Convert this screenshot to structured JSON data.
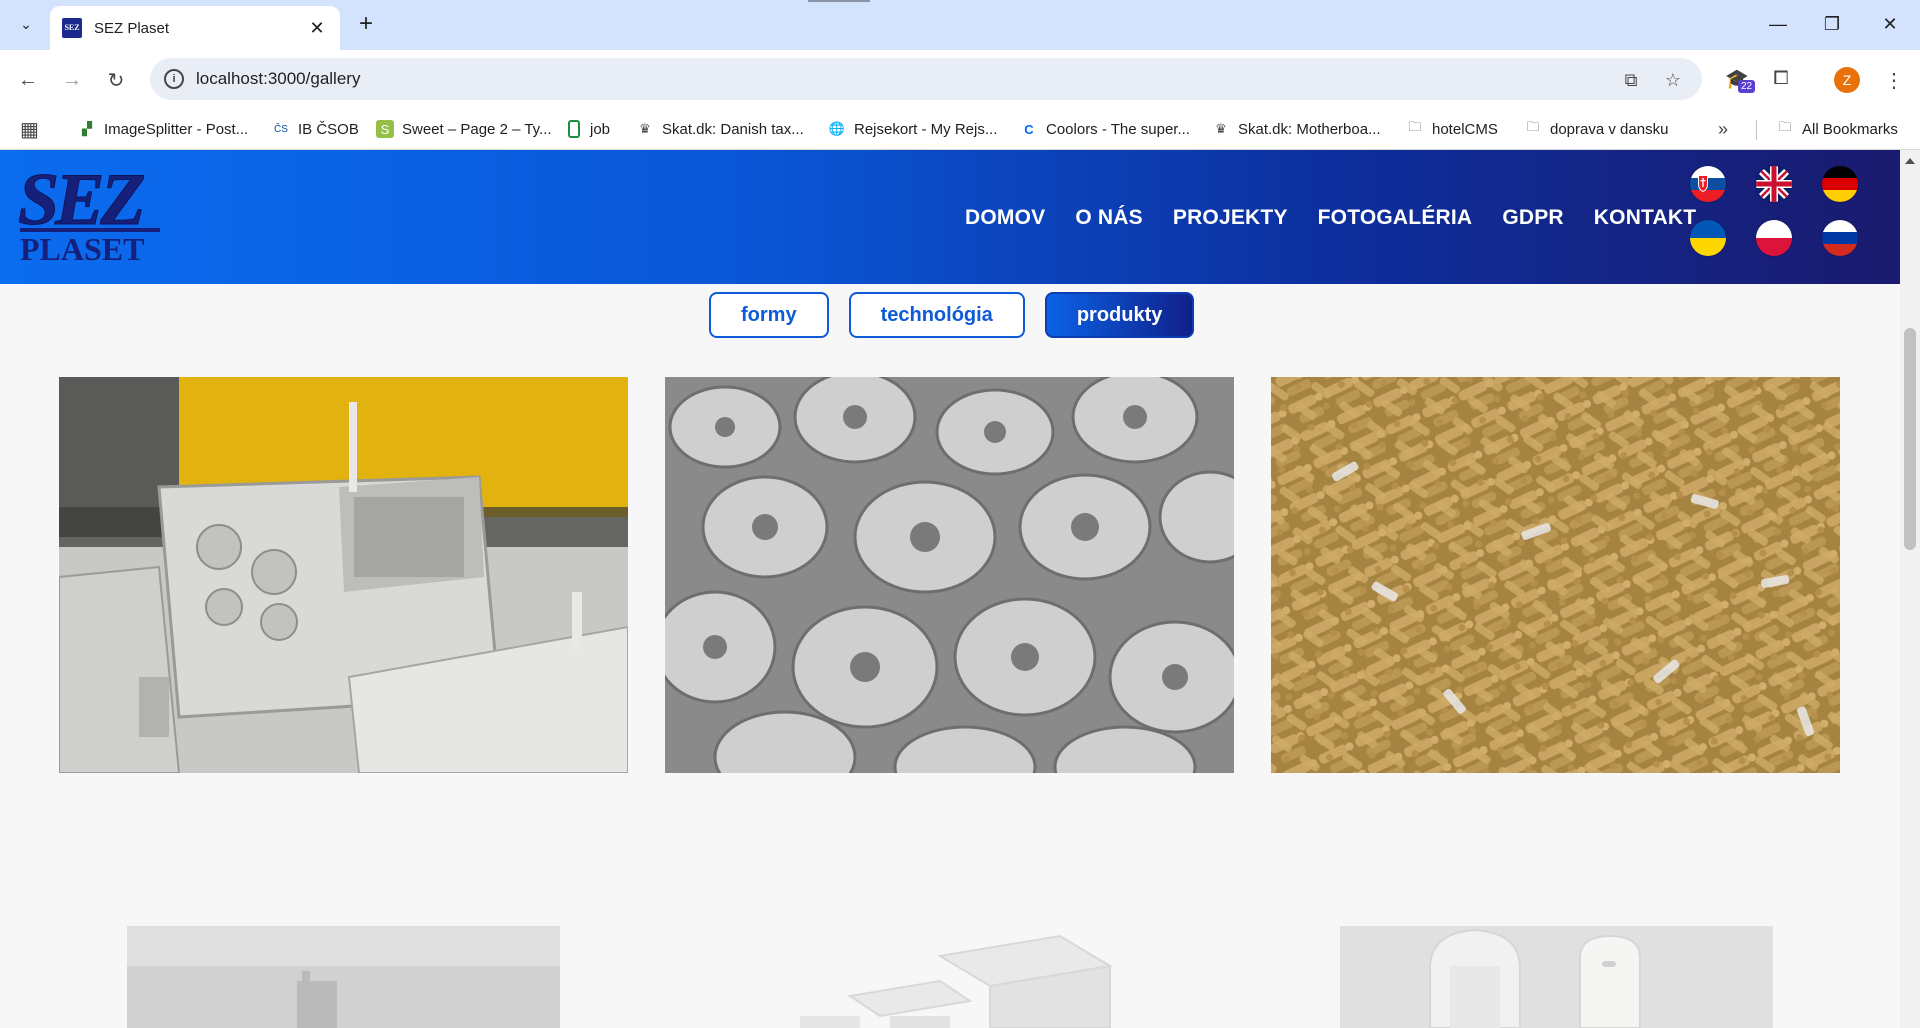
{
  "browser": {
    "tab_title": "SEZ Plaset",
    "url": "localhost:3000/gallery",
    "extension_badge": "22",
    "profile_initial": "Z",
    "favicon_text_top": "SEZ",
    "favicon_text_bottom": "PLASET"
  },
  "bookmarks": [
    {
      "label": "ImageSplitter - Post...",
      "icon": "imagesplitter-icon"
    },
    {
      "label": "IB ČSOB",
      "icon": "csob-icon"
    },
    {
      "label": "Sweet – Page 2 – Ty...",
      "icon": "shopify-icon"
    },
    {
      "label": "job",
      "icon": "sheets-icon"
    },
    {
      "label": "Skat.dk: Danish tax...",
      "icon": "crown-icon"
    },
    {
      "label": "Rejsekort - My Rejs...",
      "icon": "globe-icon"
    },
    {
      "label": "Coolors - The super...",
      "icon": "coolors-icon"
    },
    {
      "label": "Skat.dk: Motherboa...",
      "icon": "crown-icon"
    },
    {
      "label": "hotelCMS",
      "icon": "folder-icon"
    },
    {
      "label": "doprava v dansku",
      "icon": "folder-icon"
    }
  ],
  "all_bookmarks_label": "All Bookmarks",
  "site": {
    "logo_top": "SEZ",
    "logo_bottom": "PLASET",
    "nav": [
      "DOMOV",
      "O NÁS",
      "PROJEKTY",
      "FOTOGALÉRIA",
      "GDPR",
      "KONTAKT"
    ],
    "languages": [
      "sk",
      "en",
      "de",
      "uk",
      "pl",
      "ru"
    ]
  },
  "gallery": {
    "filters": [
      {
        "label": "formy",
        "active": false
      },
      {
        "label": "technológia",
        "active": false
      },
      {
        "label": "produkty",
        "active": true
      }
    ]
  },
  "colors": {
    "header_start": "#0b6cf0",
    "header_end": "#1a1a6e",
    "accent": "#0d5bd8",
    "logo": "#16207a"
  }
}
